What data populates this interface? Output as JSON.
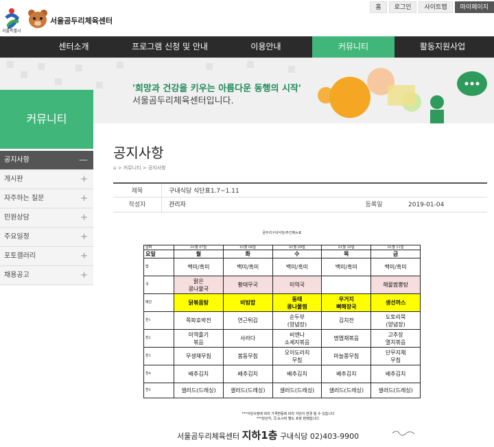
{
  "header": {
    "site_name": "서울곰두리체육센터",
    "seoul_label": "서울특별시",
    "util_links": [
      "홈",
      "로그인",
      "사이트맵",
      "마이페이지"
    ]
  },
  "gnb": [
    "센터소개",
    "프로그램 신청 및 안내",
    "이용안내",
    "커뮤니티",
    "활동지원사업"
  ],
  "banner": {
    "quote": "'희망과 건강을 키우는 아름다운 동행의 시작'",
    "sub": "서울곰두리체육센터입니다."
  },
  "lnb": {
    "title": "커뮤니티",
    "items": [
      {
        "label": "공지사항",
        "sign": "—"
      },
      {
        "label": "게시판",
        "sign": "+"
      },
      {
        "label": "자주하는 질문",
        "sign": "+"
      },
      {
        "label": "민원상담",
        "sign": "+"
      },
      {
        "label": "주요일정",
        "sign": "+"
      },
      {
        "label": "포토갤러리",
        "sign": "+"
      },
      {
        "label": "채용공고",
        "sign": "+"
      }
    ]
  },
  "page": {
    "title": "공지사항",
    "breadcrumb": "⌂ > 커뮤니티 > 공지사항"
  },
  "post": {
    "subject_label": "제목",
    "subject": "구내식당 식단표1.7~1.11",
    "author_label": "작성자",
    "author": "관리자",
    "date_label": "등록일",
    "date": "2019-01-04"
  },
  "menu": {
    "caption": "곰두리구내식당/주간메뉴표",
    "date_label": "날짜",
    "day_label": "요일",
    "dates": [
      "01월 07일",
      "01월 08일",
      "01월 09일",
      "01월 10일",
      "01월 11일"
    ],
    "days": [
      "월",
      "화",
      "수",
      "목",
      "금"
    ],
    "rows": [
      {
        "label": "밥",
        "cells": [
          "백미/흑미",
          "백미/흑미",
          "백미/흑미",
          "백미/흑미",
          "백미/흑미"
        ],
        "bg": [
          "",
          "",
          "",
          "",
          ""
        ]
      },
      {
        "label": "국",
        "cells": [
          "맑은\n콩나물국",
          "황태무국",
          "미역국",
          "",
          "해물짬뽕탕"
        ],
        "bg": [
          "pink",
          "pink",
          "pink",
          "",
          "pink"
        ]
      },
      {
        "label": "메인",
        "cells": [
          "닭볶음탕",
          "비빔밥",
          "동태\n콩나물찜",
          "우거지\n뼈해장국",
          "생선까스"
        ],
        "bg": [
          "yel",
          "yel",
          "yel",
          "yel",
          "yel"
        ]
      },
      {
        "label": "찬1",
        "cells": [
          "쪽파호박전",
          "연근튀김",
          "순두부\n(양념장)",
          "김치전",
          "도토리묵\n(양념장)"
        ],
        "bg": [
          "",
          "",
          "",
          "",
          ""
        ]
      },
      {
        "label": "찬2",
        "cells": [
          "미역줄기\n볶음",
          "사라다",
          "비엔나\n소세지볶음",
          "명엽채볶음",
          "고추장\n멸치볶음"
        ],
        "bg": [
          "",
          "",
          "",
          "",
          ""
        ]
      },
      {
        "label": "찬3",
        "cells": [
          "무생채무침",
          "봄동무침",
          "오이도라지\n무침",
          "마늘쫑무침",
          "단무지채\n무침"
        ],
        "bg": [
          "",
          "",
          "",
          "",
          ""
        ]
      },
      {
        "label": "찬4",
        "cells": [
          "배추김치",
          "배추김치",
          "배추김치",
          "배추김치",
          "배추김치"
        ],
        "bg": [
          "",
          "",
          "",
          "",
          ""
        ]
      },
      {
        "label": "찬5",
        "cells": [
          "샐러드(드레싱)",
          "샐러드(드레싱)",
          "샐러드(드레싱)",
          "샐러드(드레싱)",
          "샐러드(드레싱)"
        ],
        "bg": [
          "",
          "",
          "",
          "",
          ""
        ]
      }
    ],
    "note1": "***식당사정에 따라 가격변동에 따라 식단이 변경 될 수 있습니다",
    "note2": "***원산지, 국,도시락 별도 포장 판매합니다.",
    "footer_pre": "서울곰두리체육센터",
    "footer_floor": "지하1층",
    "footer_post": "구내식당  02)403-9900"
  },
  "colors": {
    "green": "#40b67a",
    "gnb_bg": "#2b2b2b",
    "highlight": "#ffff00",
    "pink": "#f6dede"
  }
}
